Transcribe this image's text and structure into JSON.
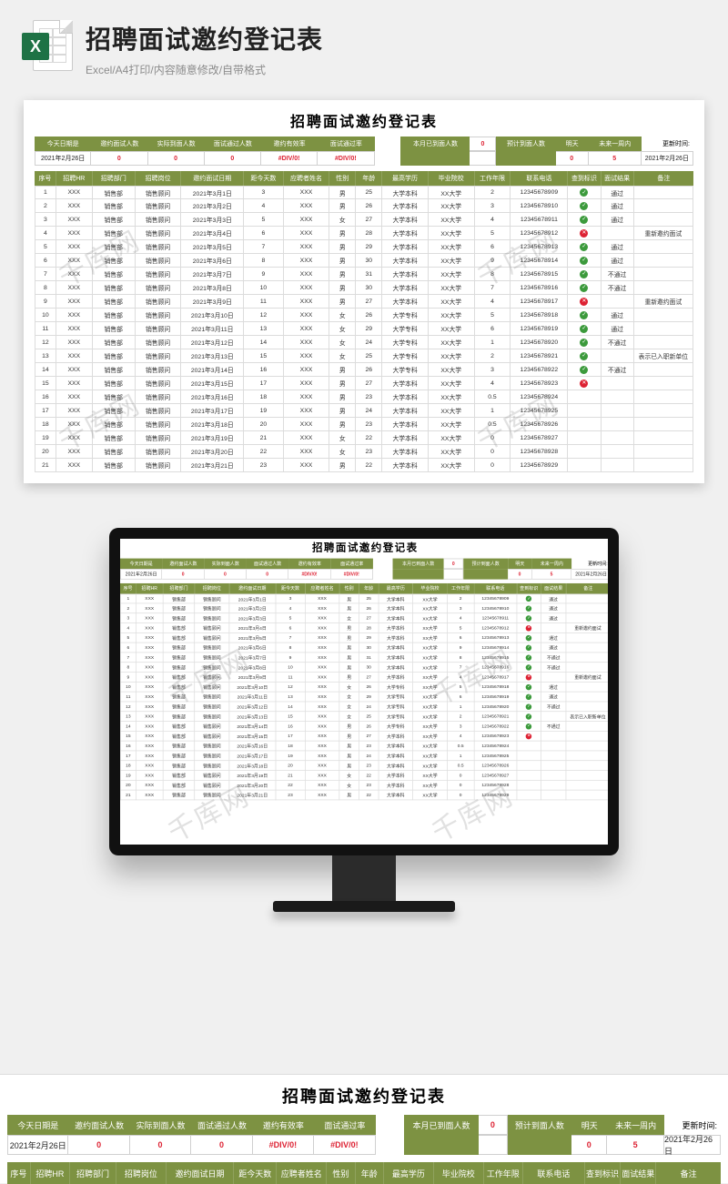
{
  "hero": {
    "title": "招聘面试邀约登记表",
    "subtitle": "Excel/A4打印/内容随意修改/自带格式"
  },
  "watermark": "千库网",
  "sheet": {
    "title": "招聘面试邀约登记表",
    "summary": {
      "labels": {
        "today": "今天日期是",
        "invite_cnt": "邀约面试人数",
        "arrive_cnt": "实际到面人数",
        "pass_cnt": "面试通过人数",
        "rate1": "邀约有效率",
        "rate2": "面试通过率",
        "month_arrive": "本月已到面人数",
        "expect_arrive": "预计到面人数",
        "tomorrow": "明天",
        "next_week": "未来一周内",
        "update_label": "更新时间:"
      },
      "values": {
        "today": "2021年2月26日",
        "invite_cnt": "0",
        "arrive_cnt": "0",
        "pass_cnt": "0",
        "rate1": "#DIV/0!",
        "rate2": "#DIV/0!",
        "month_arrive": "0",
        "tomorrow": "0",
        "next_week": "5",
        "update_time": "2021年2月26日"
      }
    },
    "columns": [
      "序号",
      "招聘HR",
      "招聘部门",
      "招聘岗位",
      "邀约面试日期",
      "距今天数",
      "应聘者姓名",
      "性别",
      "年龄",
      "最高学历",
      "毕业院校",
      "工作年限",
      "联系电话",
      "查到标识",
      "面试结果",
      "备注"
    ],
    "rows": [
      {
        "no": 1,
        "hr": "XXX",
        "dept": "销售部",
        "pos": "销售顾问",
        "date": "2021年3月1日",
        "days": 3,
        "name": "XXX",
        "sex": "男",
        "age": 25,
        "edu": "大学本科",
        "school": "XX大学",
        "exp": 2,
        "tel": "12345678909",
        "mark": "ok",
        "res": "通过",
        "note": ""
      },
      {
        "no": 2,
        "hr": "XXX",
        "dept": "销售部",
        "pos": "销售顾问",
        "date": "2021年3月2日",
        "days": 4,
        "name": "XXX",
        "sex": "男",
        "age": 26,
        "edu": "大学本科",
        "school": "XX大学",
        "exp": 3,
        "tel": "12345678910",
        "mark": "ok",
        "res": "通过",
        "note": ""
      },
      {
        "no": 3,
        "hr": "XXX",
        "dept": "销售部",
        "pos": "销售顾问",
        "date": "2021年3月3日",
        "days": 5,
        "name": "XXX",
        "sex": "女",
        "age": 27,
        "edu": "大学本科",
        "school": "XX大学",
        "exp": 4,
        "tel": "12345678911",
        "mark": "ok",
        "res": "通过",
        "note": ""
      },
      {
        "no": 4,
        "hr": "XXX",
        "dept": "销售部",
        "pos": "销售顾问",
        "date": "2021年3月4日",
        "days": 6,
        "name": "XXX",
        "sex": "男",
        "age": 28,
        "edu": "大学本科",
        "school": "XX大学",
        "exp": 5,
        "tel": "12345678912",
        "mark": "no",
        "res": "",
        "note": "重新邀约面试"
      },
      {
        "no": 5,
        "hr": "XXX",
        "dept": "销售部",
        "pos": "销售顾问",
        "date": "2021年3月5日",
        "days": 7,
        "name": "XXX",
        "sex": "男",
        "age": 29,
        "edu": "大学本科",
        "school": "XX大学",
        "exp": 6,
        "tel": "12345678913",
        "mark": "ok",
        "res": "通过",
        "note": ""
      },
      {
        "no": 6,
        "hr": "XXX",
        "dept": "销售部",
        "pos": "销售顾问",
        "date": "2021年3月6日",
        "days": 8,
        "name": "XXX",
        "sex": "男",
        "age": 30,
        "edu": "大学本科",
        "school": "XX大学",
        "exp": 9,
        "tel": "12345678914",
        "mark": "ok",
        "res": "通过",
        "note": ""
      },
      {
        "no": 7,
        "hr": "XXX",
        "dept": "销售部",
        "pos": "销售顾问",
        "date": "2021年3月7日",
        "days": 9,
        "name": "XXX",
        "sex": "男",
        "age": 31,
        "edu": "大学本科",
        "school": "XX大学",
        "exp": 8,
        "tel": "12345678915",
        "mark": "ok",
        "res": "不通过",
        "note": ""
      },
      {
        "no": 8,
        "hr": "XXX",
        "dept": "销售部",
        "pos": "销售顾问",
        "date": "2021年3月8日",
        "days": 10,
        "name": "XXX",
        "sex": "男",
        "age": 30,
        "edu": "大学本科",
        "school": "XX大学",
        "exp": 7,
        "tel": "12345678916",
        "mark": "ok",
        "res": "不通过",
        "note": ""
      },
      {
        "no": 9,
        "hr": "XXX",
        "dept": "销售部",
        "pos": "销售顾问",
        "date": "2021年3月9日",
        "days": 11,
        "name": "XXX",
        "sex": "男",
        "age": 27,
        "edu": "大学本科",
        "school": "XX大学",
        "exp": 4,
        "tel": "12345678917",
        "mark": "no",
        "res": "",
        "note": "重新邀约面试"
      },
      {
        "no": 10,
        "hr": "XXX",
        "dept": "销售部",
        "pos": "销售顾问",
        "date": "2021年3月10日",
        "days": 12,
        "name": "XXX",
        "sex": "女",
        "age": 26,
        "edu": "大学专科",
        "school": "XX大学",
        "exp": 5,
        "tel": "12345678918",
        "mark": "ok",
        "res": "通过",
        "note": ""
      },
      {
        "no": 11,
        "hr": "XXX",
        "dept": "销售部",
        "pos": "销售顾问",
        "date": "2021年3月11日",
        "days": 13,
        "name": "XXX",
        "sex": "女",
        "age": 29,
        "edu": "大学专科",
        "school": "XX大学",
        "exp": 6,
        "tel": "12345678919",
        "mark": "ok",
        "res": "通过",
        "note": ""
      },
      {
        "no": 12,
        "hr": "XXX",
        "dept": "销售部",
        "pos": "销售顾问",
        "date": "2021年3月12日",
        "days": 14,
        "name": "XXX",
        "sex": "女",
        "age": 24,
        "edu": "大学专科",
        "school": "XX大学",
        "exp": 1,
        "tel": "12345678920",
        "mark": "ok",
        "res": "不通过",
        "note": ""
      },
      {
        "no": 13,
        "hr": "XXX",
        "dept": "销售部",
        "pos": "销售顾问",
        "date": "2021年3月13日",
        "days": 15,
        "name": "XXX",
        "sex": "女",
        "age": 25,
        "edu": "大学专科",
        "school": "XX大学",
        "exp": 2,
        "tel": "12345678921",
        "mark": "ok",
        "res": "",
        "note": "表示已入职新单位"
      },
      {
        "no": 14,
        "hr": "XXX",
        "dept": "销售部",
        "pos": "销售顾问",
        "date": "2021年3月14日",
        "days": 16,
        "name": "XXX",
        "sex": "男",
        "age": 26,
        "edu": "大学专科",
        "school": "XX大学",
        "exp": 3,
        "tel": "12345678922",
        "mark": "ok",
        "res": "不通过",
        "note": ""
      },
      {
        "no": 15,
        "hr": "XXX",
        "dept": "销售部",
        "pos": "销售顾问",
        "date": "2021年3月15日",
        "days": 17,
        "name": "XXX",
        "sex": "男",
        "age": 27,
        "edu": "大学本科",
        "school": "XX大学",
        "exp": 4,
        "tel": "12345678923",
        "mark": "no",
        "res": "",
        "note": ""
      },
      {
        "no": 16,
        "hr": "XXX",
        "dept": "销售部",
        "pos": "销售顾问",
        "date": "2021年3月16日",
        "days": 18,
        "name": "XXX",
        "sex": "男",
        "age": 23,
        "edu": "大学本科",
        "school": "XX大学",
        "exp": 0.5,
        "tel": "12345678924",
        "mark": "",
        "res": "",
        "note": ""
      },
      {
        "no": 17,
        "hr": "XXX",
        "dept": "销售部",
        "pos": "销售顾问",
        "date": "2021年3月17日",
        "days": 19,
        "name": "XXX",
        "sex": "男",
        "age": 24,
        "edu": "大学本科",
        "school": "XX大学",
        "exp": 1,
        "tel": "12345678925",
        "mark": "",
        "res": "",
        "note": ""
      },
      {
        "no": 18,
        "hr": "XXX",
        "dept": "销售部",
        "pos": "销售顾问",
        "date": "2021年3月18日",
        "days": 20,
        "name": "XXX",
        "sex": "男",
        "age": 23,
        "edu": "大学本科",
        "school": "XX大学",
        "exp": 0.5,
        "tel": "12345678926",
        "mark": "",
        "res": "",
        "note": ""
      },
      {
        "no": 19,
        "hr": "XXX",
        "dept": "销售部",
        "pos": "销售顾问",
        "date": "2021年3月19日",
        "days": 21,
        "name": "XXX",
        "sex": "女",
        "age": 22,
        "edu": "大学本科",
        "school": "XX大学",
        "exp": 0,
        "tel": "12345678927",
        "mark": "",
        "res": "",
        "note": ""
      },
      {
        "no": 20,
        "hr": "XXX",
        "dept": "销售部",
        "pos": "销售顾问",
        "date": "2021年3月20日",
        "days": 22,
        "name": "XXX",
        "sex": "女",
        "age": 23,
        "edu": "大学本科",
        "school": "XX大学",
        "exp": 0,
        "tel": "12345678928",
        "mark": "",
        "res": "",
        "note": ""
      },
      {
        "no": 21,
        "hr": "XXX",
        "dept": "销售部",
        "pos": "销售顾问",
        "date": "2021年3月21日",
        "days": 23,
        "name": "XXX",
        "sex": "男",
        "age": 22,
        "edu": "大学本科",
        "school": "XX大学",
        "exp": 0,
        "tel": "12345678929",
        "mark": "",
        "res": "",
        "note": ""
      }
    ]
  }
}
